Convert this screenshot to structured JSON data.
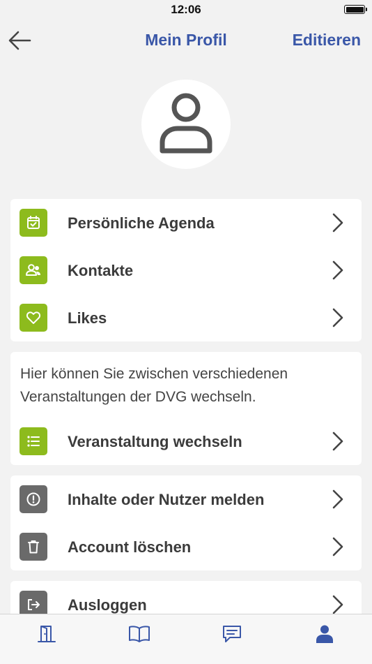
{
  "status_bar": {
    "time": "12:06"
  },
  "header": {
    "title": "Mein Profil",
    "edit_label": "Editieren"
  },
  "menu_main": {
    "items": [
      {
        "label": "Persönliche Agenda",
        "icon": "calendar-check-icon"
      },
      {
        "label": "Kontakte",
        "icon": "contacts-icon"
      },
      {
        "label": "Likes",
        "icon": "heart-icon"
      }
    ]
  },
  "event_switch": {
    "description": "Hier können Sie zwischen verschiedenen Veranstaltungen der DVG wechseln.",
    "item": {
      "label": "Veranstaltung wechseln",
      "icon": "list-icon"
    }
  },
  "menu_account": {
    "items": [
      {
        "label": "Inhalte oder Nutzer melden",
        "icon": "alert-circle-icon"
      },
      {
        "label": "Account löschen",
        "icon": "trash-icon"
      }
    ]
  },
  "menu_logout": {
    "label": "Ausloggen",
    "icon": "logout-icon"
  },
  "tab_bar": {
    "tabs": [
      {
        "name": "tab-door",
        "icon": "door-icon",
        "active": false
      },
      {
        "name": "tab-book",
        "icon": "book-icon",
        "active": false
      },
      {
        "name": "tab-messages",
        "icon": "message-icon",
        "active": false
      },
      {
        "name": "tab-profile",
        "icon": "person-icon",
        "active": true
      }
    ]
  },
  "colors": {
    "accent_blue": "#3a57a8",
    "icon_green": "#8dbb1d",
    "icon_gray": "#6a6a6a",
    "inactive_tab": "#3a57a8"
  }
}
